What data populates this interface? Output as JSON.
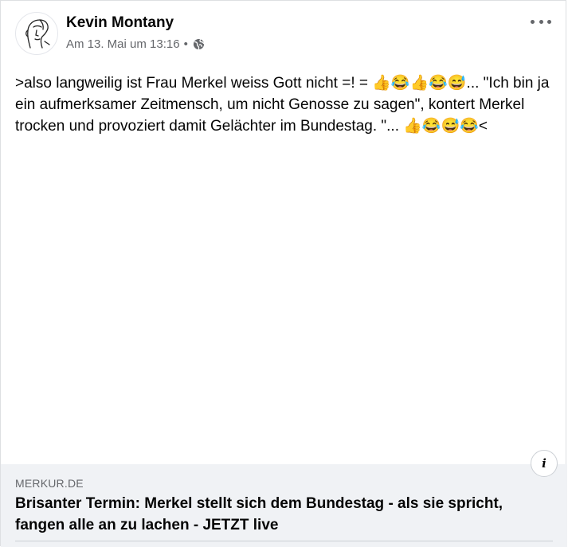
{
  "post": {
    "author": "Kevin Montany",
    "timestamp": "Am 13. Mai um 13:16",
    "separator": "•",
    "privacy_icon": "globe-icon",
    "more_icon": "more-options-icon",
    "text": ">also langweilig ist Frau Merkel weiss Gott nicht =! = 👍😂👍😂😅... \"Ich bin ja ein aufmerksamer Zeitmensch, um nicht Genosse zu sagen\", kontert Merkel trocken und provoziert damit Gelächter im Bundestag. \"... 👍😂😅😂<"
  },
  "link_preview": {
    "domain": "MERKUR.DE",
    "title": "Brisanter Termin: Merkel stellt sich dem Bundestag - als sie spricht, fangen alle an zu lachen - JETZT live",
    "info_label": "i",
    "info_icon": "info-icon"
  },
  "colors": {
    "secondary_text": "#65676b",
    "card_background": "#f0f2f5",
    "primary_text": "#050505"
  }
}
